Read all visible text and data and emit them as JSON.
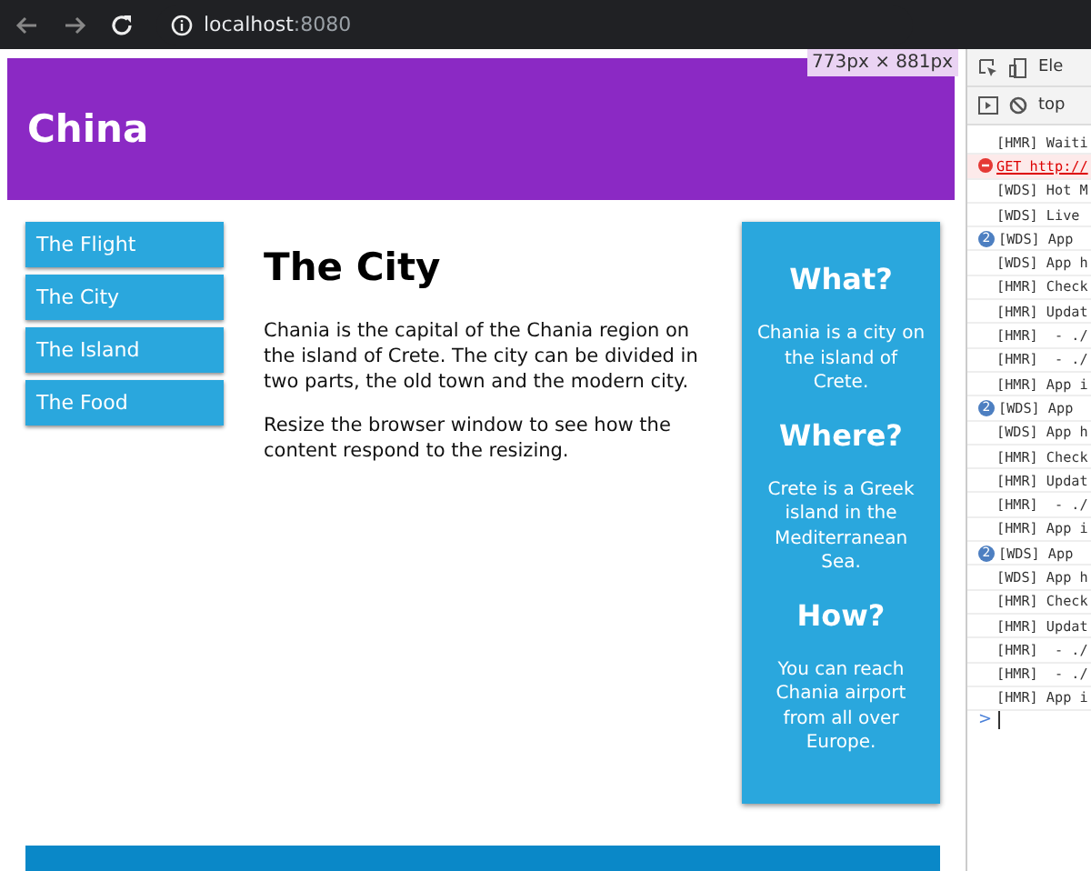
{
  "browser": {
    "url_host": "localhost",
    "url_port": ":8080"
  },
  "size_tooltip": "773px × 881px",
  "header": {
    "title": "China"
  },
  "menu": [
    {
      "label": "The Flight"
    },
    {
      "label": "The City"
    },
    {
      "label": "The Island"
    },
    {
      "label": "The Food"
    }
  ],
  "main": {
    "heading": "The City",
    "paragraphs": [
      "Chania is the capital of the Chania region on the island of Crete. The city can be divided in two parts, the old town and the modern city.",
      "Resize the browser window to see how the content respond to the resizing."
    ]
  },
  "aside": [
    {
      "heading": "What?",
      "text": "Chania is a city on the island of Crete."
    },
    {
      "heading": "Where?",
      "text": "Crete is a Greek island in the Mediterranean Sea."
    },
    {
      "heading": "How?",
      "text": "You can reach Chania airport from all over Europe."
    }
  ],
  "devtools": {
    "tab": "Ele",
    "context": "top",
    "console": [
      {
        "kind": "plain",
        "text": "[HMR] Waiti"
      },
      {
        "kind": "error",
        "text": "GET http://"
      },
      {
        "kind": "plain",
        "text": "[WDS] Hot M"
      },
      {
        "kind": "plain",
        "text": "[WDS] Live"
      },
      {
        "kind": "grouped",
        "count": "2",
        "text": "[WDS] App"
      },
      {
        "kind": "plain",
        "text": "[WDS] App h"
      },
      {
        "kind": "plain",
        "text": "[HMR] Check"
      },
      {
        "kind": "plain",
        "text": "[HMR] Updat"
      },
      {
        "kind": "plain",
        "text": "[HMR]  - ./"
      },
      {
        "kind": "plain",
        "text": "[HMR]  - ./"
      },
      {
        "kind": "plain",
        "text": "[HMR] App i"
      },
      {
        "kind": "grouped",
        "count": "2",
        "text": "[WDS] App"
      },
      {
        "kind": "plain",
        "text": "[WDS] App h"
      },
      {
        "kind": "plain",
        "text": "[HMR] Check"
      },
      {
        "kind": "plain",
        "text": "[HMR] Updat"
      },
      {
        "kind": "plain",
        "text": "[HMR]  - ./"
      },
      {
        "kind": "plain",
        "text": "[HMR] App i"
      },
      {
        "kind": "grouped",
        "count": "2",
        "text": "[WDS] App"
      },
      {
        "kind": "plain",
        "text": "[WDS] App h"
      },
      {
        "kind": "plain",
        "text": "[HMR] Check"
      },
      {
        "kind": "plain",
        "text": "[HMR] Updat"
      },
      {
        "kind": "plain",
        "text": "[HMR]  - ./"
      },
      {
        "kind": "plain",
        "text": "[HMR]  - ./"
      },
      {
        "kind": "plain",
        "text": "[HMR] App i"
      }
    ],
    "prompt": ">"
  }
}
